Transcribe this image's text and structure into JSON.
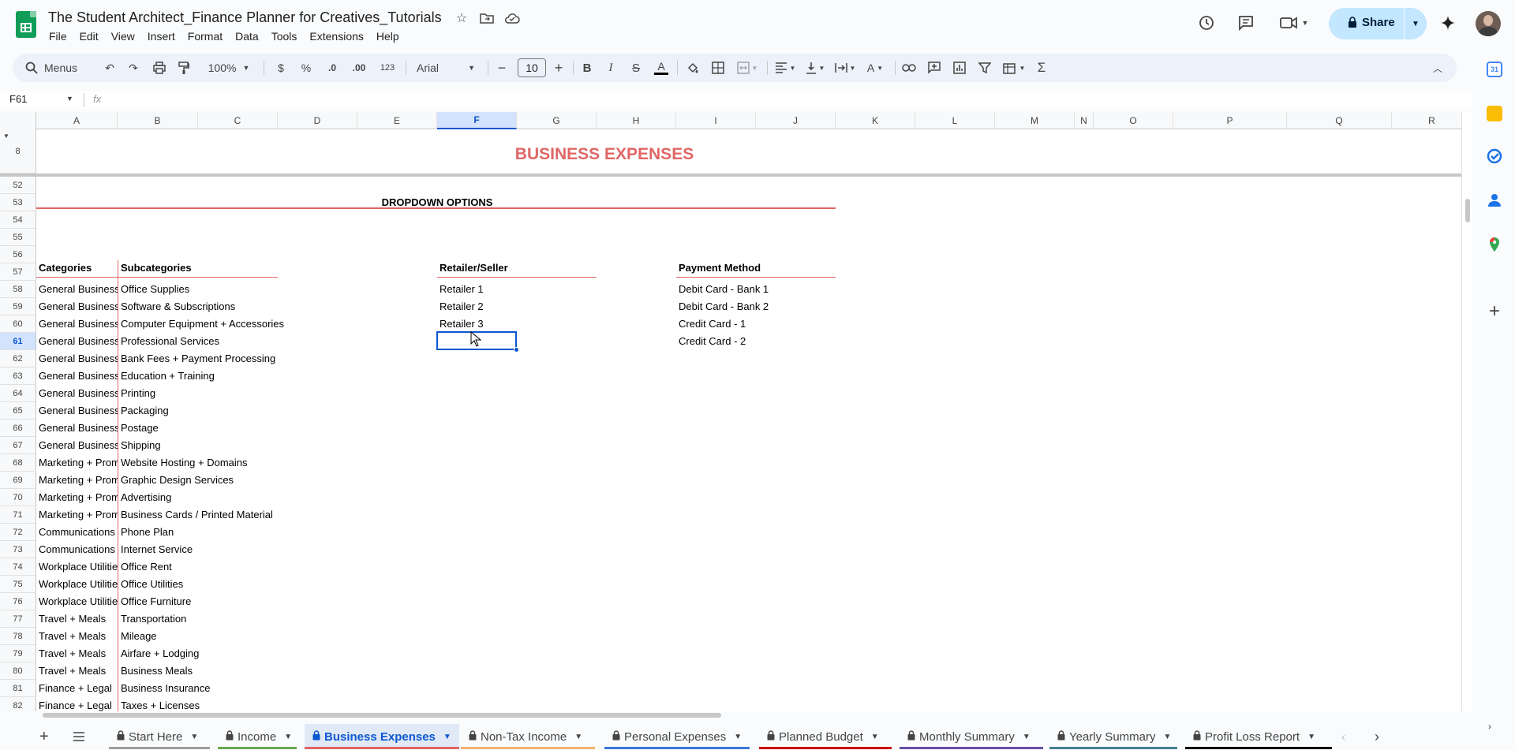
{
  "doc": {
    "title": "The Student Architect_Finance Planner for Creatives_Tutorials",
    "menus": [
      "File",
      "Edit",
      "View",
      "Insert",
      "Format",
      "Data",
      "Tools",
      "Extensions",
      "Help"
    ]
  },
  "header": {
    "share_label": "Share"
  },
  "toolbar": {
    "search_label": "Menus",
    "zoom": "100%",
    "currency": "$",
    "percent": "%",
    "decrease_decimal": ".0",
    "increase_decimal": ".00",
    "number_format": "123",
    "font": "Arial",
    "font_size": "10",
    "bold": "B",
    "italic": "I",
    "strike": "S",
    "text_color": "A"
  },
  "formula": {
    "name_box": "F61",
    "fx": "fx"
  },
  "columns": [
    "A",
    "B",
    "C",
    "D",
    "E",
    "F",
    "G",
    "H",
    "I",
    "J",
    "K",
    "L",
    "M",
    "N",
    "O",
    "P",
    "Q",
    "R"
  ],
  "active_column": "F",
  "frozen_row": "8",
  "rows": [
    "52",
    "53",
    "54",
    "55",
    "56",
    "57",
    "58",
    "59",
    "60",
    "61",
    "62",
    "63",
    "64",
    "65",
    "66",
    "67",
    "68",
    "69",
    "70",
    "71",
    "72",
    "73",
    "74",
    "75",
    "76",
    "77",
    "78",
    "79",
    "80",
    "81",
    "82"
  ],
  "active_row": "61",
  "sheet": {
    "title": "BUSINESS EXPENSES",
    "dropdown_title": "DROPDOWN OPTIONS",
    "headers": {
      "categories": "Categories",
      "subcategories": "Subcategories",
      "retailer": "Retailer/Seller",
      "payment": "Payment Method"
    },
    "categories": [
      "General Business",
      "General Business",
      "General Business",
      "General Business",
      "General Business",
      "General Business",
      "General Business",
      "General Business",
      "General Business",
      "General Business",
      "Marketing + Promotion",
      "Marketing + Promotion",
      "Marketing + Promotion",
      "Marketing + Promotion",
      "Communications",
      "Communications",
      "Workplace Utilities",
      "Workplace Utilities",
      "Workplace Utilities",
      "Travel + Meals",
      "Travel + Meals",
      "Travel + Meals",
      "Travel + Meals",
      "Finance + Legal",
      "Finance + Legal"
    ],
    "subcategories": [
      "Office Supplies",
      "Software & Subscriptions",
      "Computer Equipment + Accessories",
      "Professional Services",
      "Bank Fees + Payment Processing",
      "Education + Training",
      "Printing",
      "Packaging",
      "Postage",
      "Shipping",
      "Website Hosting + Domains",
      "Graphic Design Services",
      "Advertising",
      "Business Cards / Printed Material",
      "Phone Plan",
      "Internet Service",
      "Office Rent",
      "Office Utilities",
      "Office Furniture",
      "Transportation",
      "Mileage",
      "Airfare + Lodging",
      "Business Meals",
      "Business Insurance",
      "Taxes + Licenses"
    ],
    "retailers": [
      "Retailer 1",
      "Retailer 2",
      "Retailer 3"
    ],
    "payments": [
      "Debit Card - Bank 1",
      "Debit Card - Bank 2",
      "Credit Card - 1",
      "Credit Card - 2"
    ]
  },
  "tabs": [
    {
      "label": "Start Here",
      "color": "#9e9e9e"
    },
    {
      "label": "Income",
      "color": "#6aa84f"
    },
    {
      "label": "Business Expenses",
      "color": "#e06666"
    },
    {
      "label": "Non-Tax Income",
      "color": "#f6b26b"
    },
    {
      "label": "Personal Expenses",
      "color": "#3c78d8"
    },
    {
      "label": "Planned Budget",
      "color": "#cc0000"
    },
    {
      "label": "Monthly Summary",
      "color": "#674ea7"
    },
    {
      "label": "Yearly Summary",
      "color": "#45818e"
    },
    {
      "label": "Profit Loss Report",
      "color": "#000000"
    }
  ],
  "colors": {
    "accent": "#0b57d0",
    "title_red": "#e06666",
    "share_bg": "#c2e7ff",
    "sheets_green": "#0f9d58"
  }
}
